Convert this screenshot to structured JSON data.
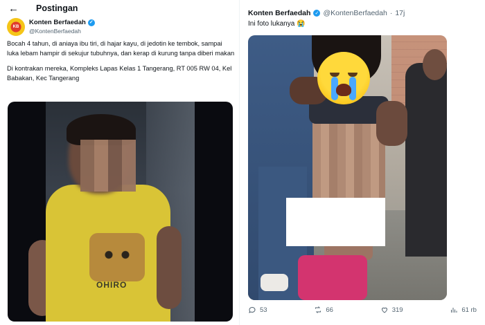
{
  "left_post": {
    "header_title": "Postingan",
    "author": {
      "display_name": "Konten Berfaedah",
      "handle": "@KontenBerfaedah"
    },
    "paragraph1": "Bocah 4 tahun, di aniaya ibu tiri, di hajar kayu, di jedotin ke tembok, sampai luka lebam hampir di sekujur tubuhnya, dan kerap di kurung tanpa diberi makan",
    "paragraph2": "Di kontrakan mereka, Kompleks Lapas Kelas 1 Tangerang, RT 005 RW 04, Kel Babakan, Kec Tangerang",
    "video_print": "OHIRO"
  },
  "right_post": {
    "display_name": "Konten Berfaedah",
    "handle": "@KontenBerfaedah",
    "dot": "·",
    "time": "17j",
    "text": "Ini foto lukanya 😭",
    "stats": {
      "replies": "53",
      "reposts": "66",
      "likes": "319",
      "views": "61 rb"
    }
  },
  "colors": {
    "verified": "#1d9bf0",
    "secondary_text": "#536471",
    "primary_text": "#0f1419"
  },
  "icons": [
    "back-arrow-icon",
    "verified-badge-icon",
    "reply-icon",
    "repost-icon",
    "like-icon",
    "views-icon",
    "crying-emoji-sticker"
  ]
}
